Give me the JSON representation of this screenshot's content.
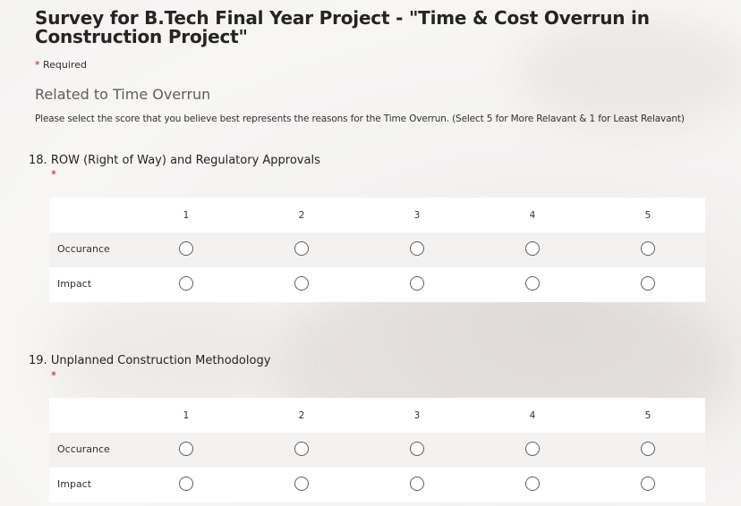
{
  "form": {
    "title": "Survey for B.Tech Final Year Project - \"Time & Cost Overrun in Construction Project\"",
    "required_star": "*",
    "required_text": "Required"
  },
  "section": {
    "title": "Related to Time Overrun",
    "description": "Please select the score that you believe best represents the reasons for the Time Overrun. (Select 5 for More Relavant & 1 for Least Relavant)"
  },
  "questions": [
    {
      "number": "18.",
      "text": "ROW (Right of Way) and Regulatory Approvals",
      "required_star": "*",
      "columns": [
        "1",
        "2",
        "3",
        "4",
        "5"
      ],
      "rows": [
        "Occurance",
        "Impact"
      ]
    },
    {
      "number": "19.",
      "text": "Unplanned Construction Methodology",
      "required_star": "*",
      "columns": [
        "1",
        "2",
        "3",
        "4",
        "5"
      ],
      "rows": [
        "Occurance",
        "Impact"
      ]
    }
  ],
  "colors": {
    "required": "#a4262c",
    "text": "#323130",
    "radio_border": "#605e5c",
    "row_shade": "#f3f2f1"
  }
}
